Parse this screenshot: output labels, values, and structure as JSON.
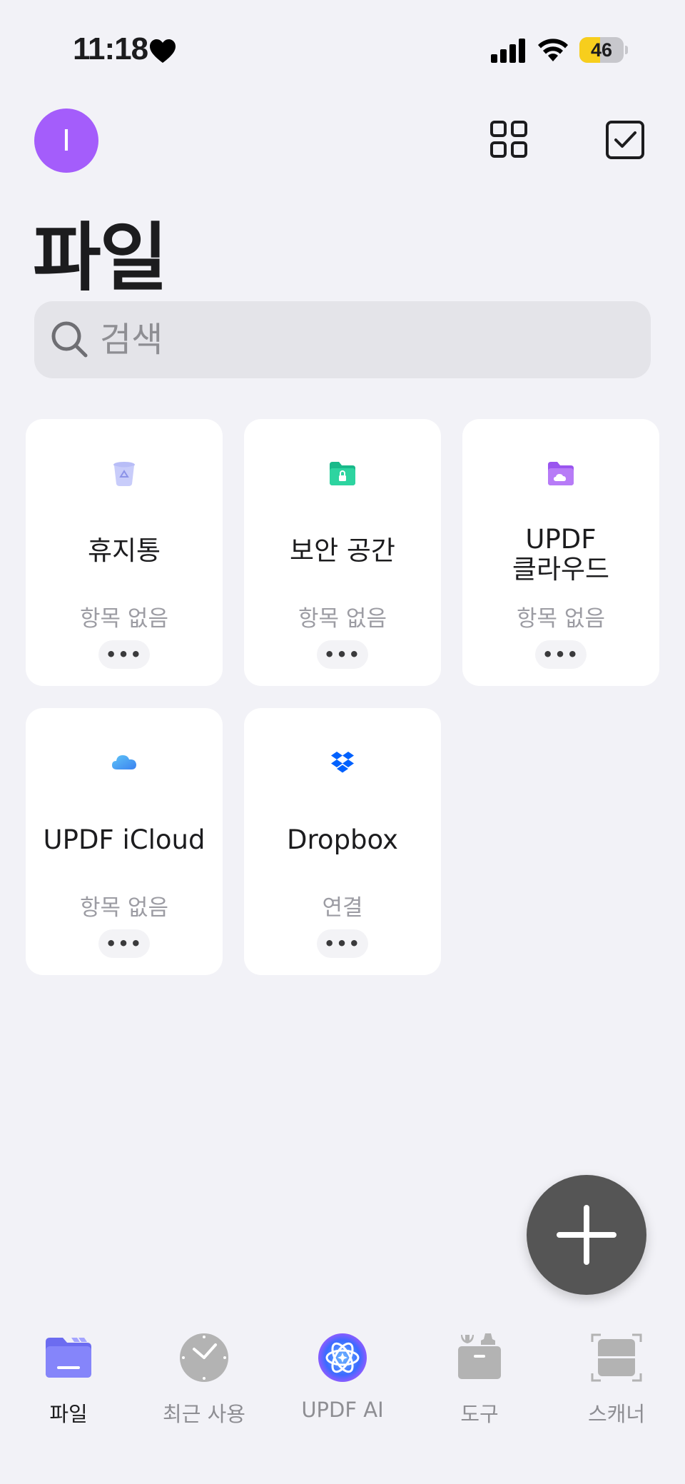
{
  "status_bar": {
    "time": "11:18",
    "battery": "46",
    "battery_level": 0.46
  },
  "header": {
    "avatar_letter": "I",
    "title": "파일"
  },
  "search": {
    "placeholder": "검색",
    "value": ""
  },
  "cards": [
    {
      "title": "휴지통",
      "subtitle": "항목 없음",
      "more": "•••",
      "icon": "trash-icon"
    },
    {
      "title": "보안 공간",
      "subtitle": "항목 없음",
      "more": "•••",
      "icon": "secure-folder-icon"
    },
    {
      "title_line1": "UPDF",
      "title_line2": "클라우드",
      "subtitle": "항목 없음",
      "more": "•••",
      "icon": "cloud-folder-icon"
    },
    {
      "title": "UPDF iCloud",
      "subtitle": "항목 없음",
      "more": "•••",
      "icon": "icloud-icon"
    },
    {
      "title": "Dropbox",
      "subtitle": "연결",
      "more": "•••",
      "icon": "dropbox-icon"
    }
  ],
  "tabs": [
    {
      "label": "파일",
      "icon": "folder-icon",
      "active": true
    },
    {
      "label": "최근 사용",
      "icon": "clock-icon",
      "active": false
    },
    {
      "label": "UPDF AI",
      "icon": "ai-icon",
      "active": false
    },
    {
      "label": "도구",
      "icon": "toolbox-icon",
      "active": false
    },
    {
      "label": "스캐너",
      "icon": "scanner-icon",
      "active": false
    }
  ],
  "colors": {
    "background": "#f2f2f7",
    "avatar": "#a45dfb",
    "battery_fill": "#f7ce1d",
    "fab": "#555555",
    "tab_active": "#7c7cf8",
    "tab_inactive": "#b3b3b3"
  }
}
